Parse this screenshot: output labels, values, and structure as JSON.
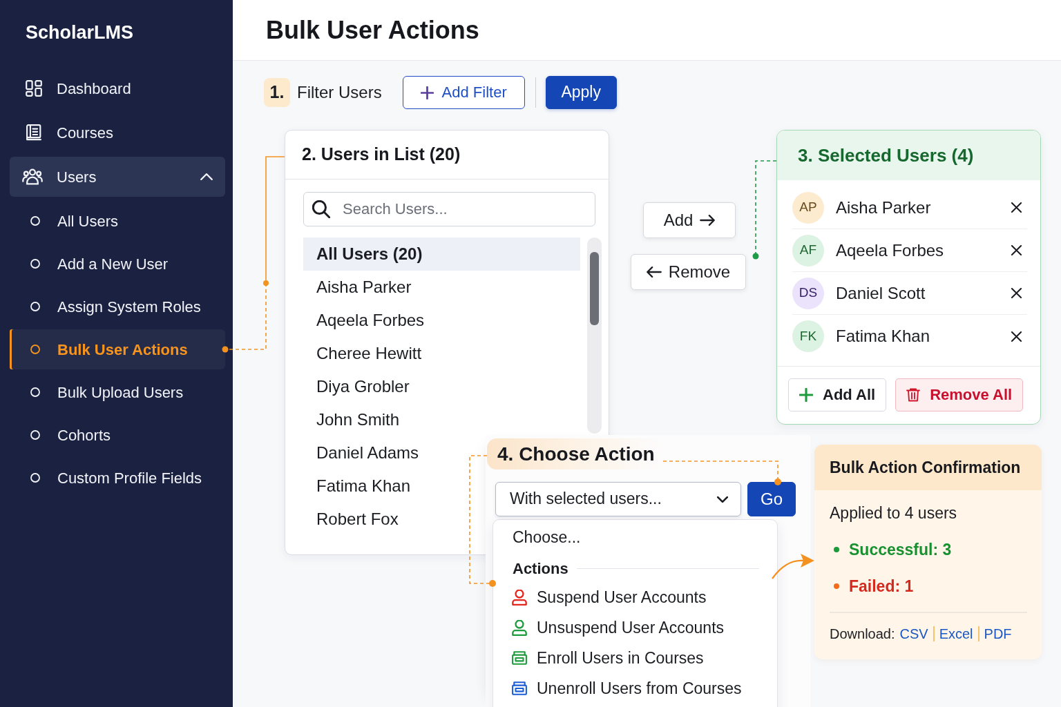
{
  "sidebar": {
    "brand": "ScholarLMS",
    "items": [
      {
        "label": "Dashboard",
        "selected": false
      },
      {
        "label": "Courses",
        "selected": false
      },
      {
        "label": "Users",
        "selected": true,
        "expanded": true,
        "children": [
          {
            "label": "All Users",
            "selected": false
          },
          {
            "label": "Add a New User",
            "selected": false
          },
          {
            "label": "Assign System Roles",
            "selected": false
          },
          {
            "label": "Bulk User Actions",
            "selected": true
          },
          {
            "label": "Bulk Upload Users",
            "selected": false
          },
          {
            "label": "Cohorts",
            "selected": false
          },
          {
            "label": "Custom Profile Fields",
            "selected": false
          }
        ]
      }
    ]
  },
  "header": {
    "title": "Bulk User Actions"
  },
  "filter": {
    "step": "1.",
    "title": "Filter Users",
    "buttons": [
      {
        "label": "Add Filter",
        "kind": "outline"
      },
      {
        "label": "Apply",
        "kind": "primary"
      }
    ]
  },
  "users_list": {
    "title": "2. Users in List (20)",
    "search": {
      "placeholder": "Search Users..."
    },
    "items": [
      {
        "label": "All Users (20)",
        "selected": true
      },
      {
        "label": "Aisha Parker",
        "selected": false
      },
      {
        "label": "Aqeela Forbes",
        "selected": false
      },
      {
        "label": "Cheree Hewitt",
        "selected": false
      },
      {
        "label": "Diya Grobler",
        "selected": false
      },
      {
        "label": "John Smith",
        "selected": false
      },
      {
        "label": "Daniel Adams",
        "selected": false
      },
      {
        "label": "Fatima Khan",
        "selected": false
      },
      {
        "label": "Robert Fox",
        "selected": false
      }
    ]
  },
  "transfer_buttons": [
    {
      "label": "Add",
      "kind": "add"
    },
    {
      "label": "Remove",
      "kind": "remove"
    }
  ],
  "selected_users": {
    "title": "3. Selected Users (4)",
    "users": [
      {
        "initials": "AP",
        "name": "Aisha Parker",
        "color": "#fdebd0"
      },
      {
        "initials": "AF",
        "name": "Aqeela Forbes",
        "color": "#dcf2e2"
      },
      {
        "initials": "DS",
        "name": "Daniel Scott",
        "color": "#ebe3fb"
      },
      {
        "initials": "FK",
        "name": "Fatima Khan",
        "color": "#dcf2e2"
      }
    ],
    "buttons": [
      {
        "label": "Add All",
        "kind": "add"
      },
      {
        "label": "Remove All",
        "kind": "remove"
      }
    ]
  },
  "action": {
    "title": "4. Choose Action",
    "select": {
      "value": "With selected users...",
      "expanded": true
    },
    "go_button": "Go",
    "menu": [
      {
        "kind": "option",
        "label": "Choose..."
      },
      {
        "kind": "header",
        "label": "Actions"
      },
      {
        "kind": "account",
        "label": "Suspend User Accounts",
        "color": "#e5261d"
      },
      {
        "kind": "account",
        "label": "Unsuspend User Accounts",
        "color": "#1e9b3c"
      },
      {
        "kind": "enrollment",
        "label": "Enroll Users in Courses",
        "color": "#1e9b3c"
      },
      {
        "kind": "enrollment",
        "label": "Unenroll Users from Courses",
        "color": "#1c5fd6"
      }
    ]
  },
  "confirmation": {
    "title": "Bulk Action Confirmation",
    "summary": "Applied to 4 users",
    "results": [
      {
        "label": "Successful: 3",
        "kind": "success",
        "color": "#1a9a3a"
      },
      {
        "label": "Failed: 1",
        "kind": "failure",
        "color": "#f26b1d"
      }
    ],
    "download": {
      "label": "Download:",
      "links": [
        "CSV",
        "Excel",
        "PDF"
      ]
    }
  }
}
